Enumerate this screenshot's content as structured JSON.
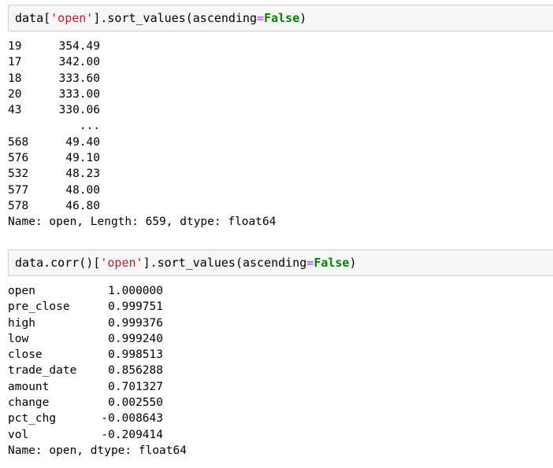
{
  "cells": [
    {
      "input": {
        "prefix": "data[",
        "string": "'open'",
        "middle": "].sort_values(ascending",
        "operator": "=",
        "keyword": "False",
        "suffix": ")"
      },
      "output": {
        "rows": [
          {
            "index": "19",
            "value": "354.49"
          },
          {
            "index": "17",
            "value": "342.00"
          },
          {
            "index": "18",
            "value": "333.60"
          },
          {
            "index": "20",
            "value": "333.00"
          },
          {
            "index": "43",
            "value": "330.06"
          },
          {
            "index": "",
            "value": "..."
          },
          {
            "index": "568",
            "value": "49.40"
          },
          {
            "index": "576",
            "value": "49.10"
          },
          {
            "index": "532",
            "value": "48.23"
          },
          {
            "index": "577",
            "value": "48.00"
          },
          {
            "index": "578",
            "value": "46.80"
          }
        ],
        "footer": "Name: open, Length: 659, dtype: float64"
      }
    },
    {
      "input": {
        "prefix": "data.corr()[",
        "string": "'open'",
        "middle": "].sort_values(ascending",
        "operator": "=",
        "keyword": "False",
        "suffix": ")"
      },
      "output": {
        "rows": [
          {
            "index": "open",
            "value": "1.000000"
          },
          {
            "index": "pre_close",
            "value": "0.999751"
          },
          {
            "index": "high",
            "value": "0.999376"
          },
          {
            "index": "low",
            "value": "0.999240"
          },
          {
            "index": "close",
            "value": "0.998513"
          },
          {
            "index": "trade_date",
            "value": "0.856288"
          },
          {
            "index": "amount",
            "value": "0.701327"
          },
          {
            "index": "change",
            "value": "0.002550"
          },
          {
            "index": "pct_chg",
            "value": "-0.008643"
          },
          {
            "index": "vol",
            "value": "-0.209414"
          }
        ],
        "footer": "Name: open, dtype: float64"
      }
    }
  ],
  "colors": {
    "string": "#ba2121",
    "keyword": "#008000",
    "operator": "#aa22ff",
    "cell_background": "#f7f7f7",
    "cell_border": "#cfcfcf"
  }
}
